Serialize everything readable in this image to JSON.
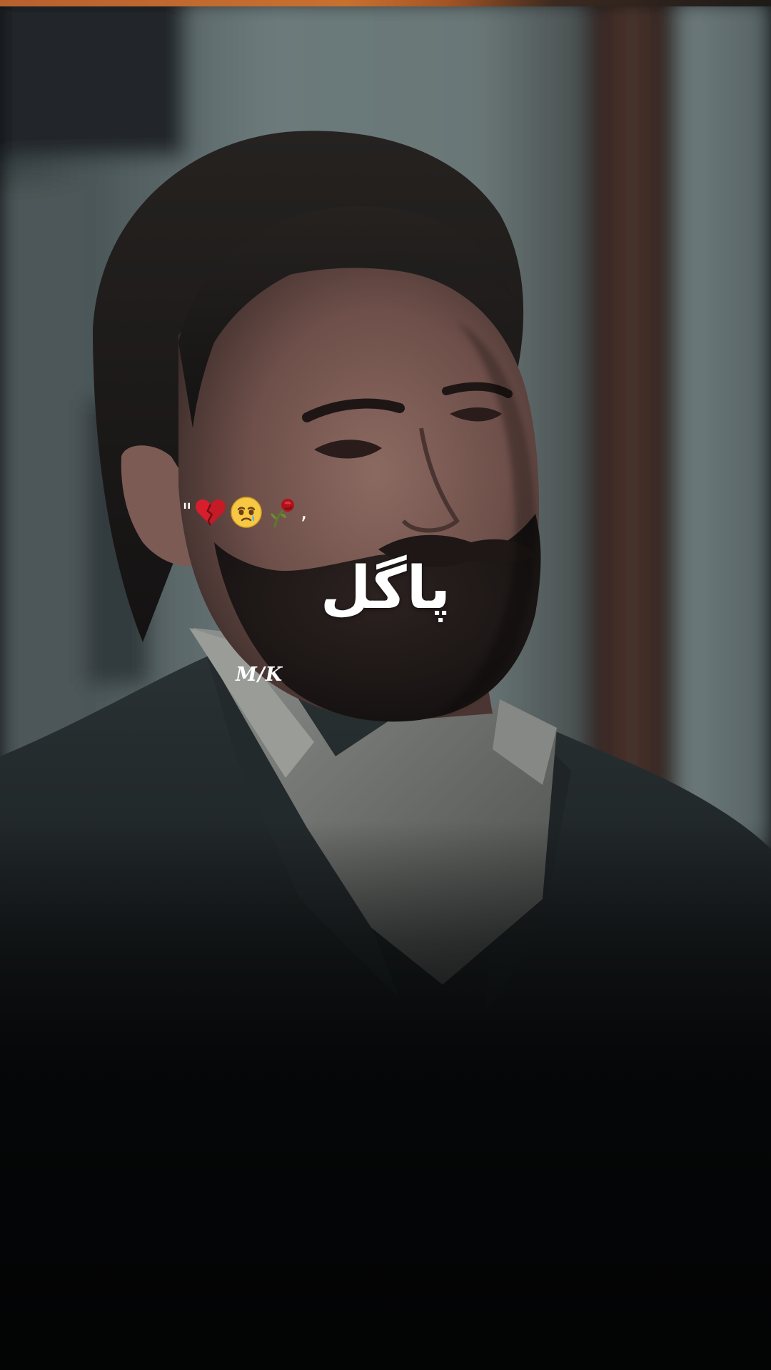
{
  "scene": {
    "palette": {
      "stripe": "#c46a30",
      "background_wall": "#5c6a6c",
      "door_frame": "#3e2a24",
      "suit": "#1c2224",
      "shirt": "#7d7f7c",
      "skin": "#7a5a52",
      "hair": "#1d1a18",
      "text": "#ffffff"
    }
  },
  "overlay": {
    "caption_quote": "\"",
    "caption_emojis": [
      "broken-heart-icon",
      "crying-face-icon",
      "wilted-rose-icon"
    ],
    "caption_comma": ",",
    "title_text": "پاگل",
    "signature_text": "M/K"
  }
}
